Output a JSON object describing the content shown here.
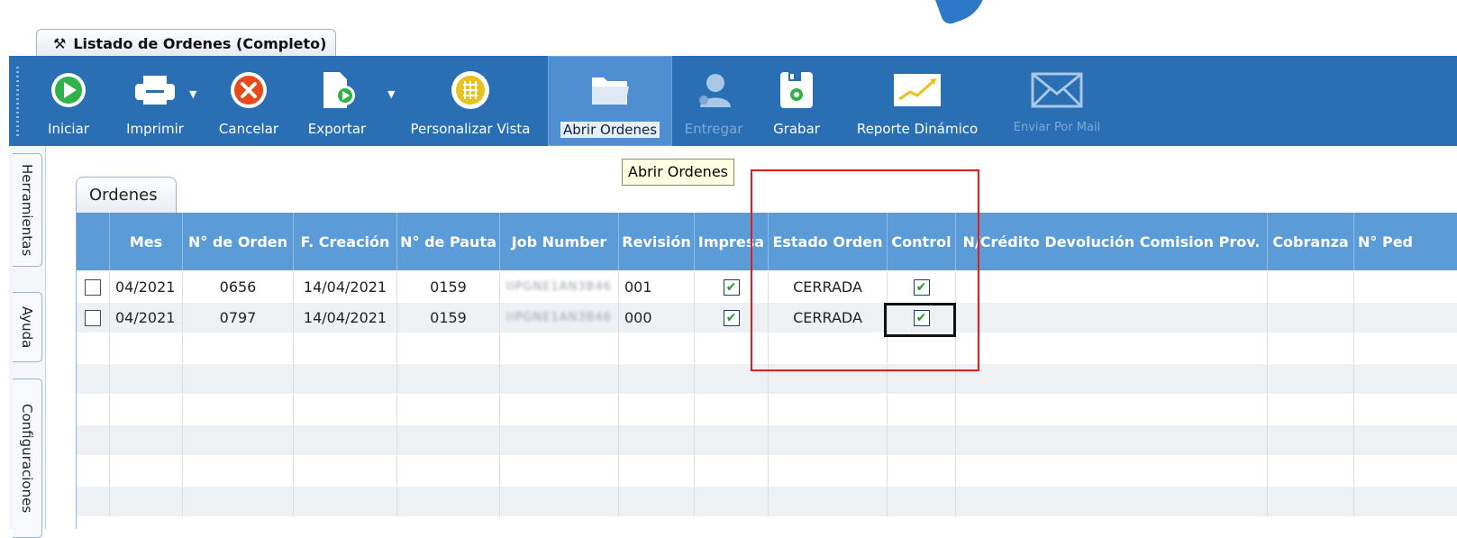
{
  "document_tab": {
    "label": "Listado de Ordenes (Completo)"
  },
  "toolbar": {
    "buttons": [
      {
        "label": "Iniciar",
        "icon": "play-circle-icon",
        "enabled": true
      },
      {
        "label": "Imprimir",
        "icon": "printer-icon",
        "enabled": true
      },
      {
        "label": "Cancelar",
        "icon": "cancel-circle-icon",
        "enabled": true
      },
      {
        "label": "Exportar",
        "icon": "export-document-icon",
        "enabled": true
      },
      {
        "label": "Personalizar Vista",
        "icon": "grid-circle-icon",
        "enabled": true
      },
      {
        "label": "Abrir Ordenes",
        "icon": "open-folder-icon",
        "enabled": true,
        "active": true
      },
      {
        "label": "Entregar",
        "icon": "user-icon",
        "enabled": false
      },
      {
        "label": "Grabar",
        "icon": "floppy-disk-icon",
        "enabled": true
      },
      {
        "label": "Reporte Dinámico",
        "icon": "chart-icon",
        "enabled": true
      },
      {
        "label": "Enviar Por Mail",
        "icon": "envelope-icon",
        "enabled": false
      }
    ],
    "tooltip": "Abrir Ordenes"
  },
  "side_tabs": [
    "Herramientas",
    "Ayuda",
    "Configuraciones"
  ],
  "orders_tab": {
    "label": "Ordenes"
  },
  "grid": {
    "columns": [
      "Mes",
      "N° de Orden",
      "F. Creación",
      "N° de Pauta",
      "Job Number",
      "Revisión",
      "Impresa",
      "Estado Orden",
      "Control",
      "N/Crédito Devolución Comision Prov.",
      "Cobranza",
      "N° Ped"
    ],
    "rows": [
      {
        "selected": false,
        "mes": "04/2021",
        "orden": "0656",
        "creacion": "14/04/2021",
        "pauta": "0159",
        "job": "IIPGNE1AN3B46",
        "revision": "001",
        "impresa": true,
        "estado": "CERRADA",
        "control": true
      },
      {
        "selected": false,
        "mes": "04/2021",
        "orden": "0797",
        "creacion": "14/04/2021",
        "pauta": "0159",
        "job": "IIPGNE1AN3B46",
        "revision": "000",
        "impresa": true,
        "estado": "CERRADA",
        "control": true
      }
    ]
  },
  "colors": {
    "toolbar": "#2a6eb3",
    "header": "#5a9bd8",
    "highlight_red": "#e21b1b",
    "check_green": "#1f9a2a"
  }
}
